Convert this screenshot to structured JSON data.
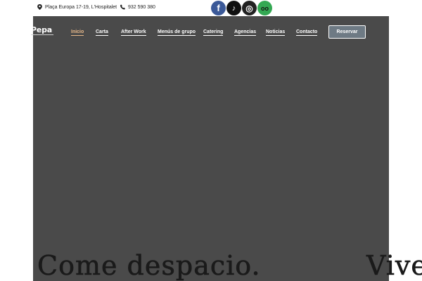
{
  "topbar": {
    "address": "Plaça Europa 17-19, L'Hospitalet",
    "phone": "932 590 380",
    "socials": [
      {
        "icon": "facebook-icon",
        "color": "#3b5998",
        "glyph": "f"
      },
      {
        "icon": "tiktok-icon",
        "color": "#111111",
        "glyph": "♪"
      },
      {
        "icon": "instagram-icon",
        "color": "#222222",
        "glyph": "◎"
      },
      {
        "icon": "tripadvisor-icon",
        "color": "#34a853",
        "glyph": "oo"
      }
    ]
  },
  "header": {
    "logo": "Pepa",
    "nav": [
      {
        "label": "Inicio",
        "active": true
      },
      {
        "label": "Carta"
      },
      {
        "label": "After Work"
      },
      {
        "label": "Menús de grupo"
      },
      {
        "label": "Catering"
      },
      {
        "label": "Agencias"
      },
      {
        "label": "Noticias"
      },
      {
        "label": "Contacto"
      }
    ],
    "cta": "Reservar"
  },
  "hero": {
    "headline_left": "Come despacio.",
    "headline_right": "Vive"
  },
  "colors": {
    "hero_bg": "#4a4a4a",
    "accent": "#e8b98a",
    "cta_bg": "#6e7a84"
  }
}
